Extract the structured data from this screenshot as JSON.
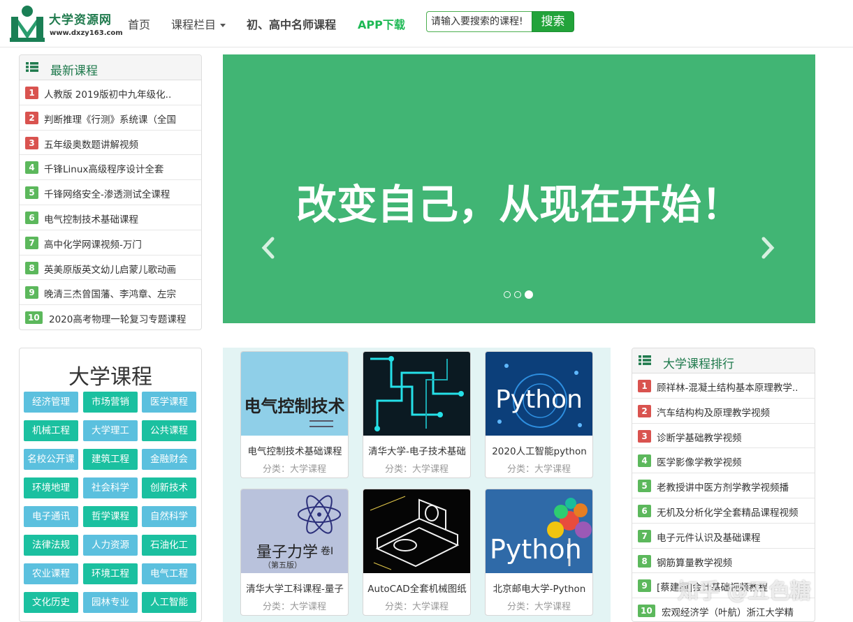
{
  "header": {
    "logo_title": "大学资源网",
    "logo_url": "www.dxzy163.com",
    "nav": {
      "home": "首页",
      "columns": "课程栏目",
      "teachers": "初、高中名师课程",
      "app": "APP下载"
    },
    "search": {
      "placeholder": "请输入要搜索的课程!",
      "button": "搜索"
    }
  },
  "latest": {
    "title": "最新课程",
    "items": [
      {
        "num": "1",
        "text": "人教版 2019版初中九年级化.."
      },
      {
        "num": "2",
        "text": "判断推理《行测》系统课（全国"
      },
      {
        "num": "3",
        "text": "五年级奥数题讲解视频"
      },
      {
        "num": "4",
        "text": "千锋Linux高级程序设计全套"
      },
      {
        "num": "5",
        "text": "千锋网络安全-渗透测试全课程"
      },
      {
        "num": "6",
        "text": "电气控制技术基础课程"
      },
      {
        "num": "7",
        "text": "高中化学网课视频-万门"
      },
      {
        "num": "8",
        "text": "英美原版英文幼儿启蒙儿歌动画"
      },
      {
        "num": "9",
        "text": "晚清三杰曾国藩、李鸿章、左宗"
      },
      {
        "num": "10",
        "text": "2020高考物理一轮复习专题课程"
      }
    ]
  },
  "banner": {
    "text": "改变自己，从现在开始！",
    "slide_count": 3,
    "active_slide": 3
  },
  "categories": {
    "title": "大学课程",
    "tags": [
      "经济管理",
      "市场营销",
      "医学课程",
      "机械工程",
      "大学理工",
      "公共课程",
      "名校公开课",
      "建筑工程",
      "金融财会",
      "环境地理",
      "社会科学",
      "创新技术",
      "电子通讯",
      "哲学课程",
      "自然科学",
      "法律法规",
      "人力资源",
      "石油化工",
      "农业课程",
      "环境工程",
      "电气工程",
      "文化历史",
      "园林专业",
      "人工智能"
    ]
  },
  "cards": [
    {
      "title": "电气控制技术基础课程",
      "meta": "分类：大学课程",
      "thumb_text": "电气控制技术"
    },
    {
      "title": "清华大学-电子技术基础",
      "meta": "分类：大学课程",
      "thumb_text": ""
    },
    {
      "title": "2020人工智能python",
      "meta": "分类：大学课程",
      "thumb_text": "Python"
    },
    {
      "title": "清华大学工科课程-量子",
      "meta": "分类：大学课程",
      "thumb_text": "量子力学",
      "thumb_sub": "卷I",
      "thumb_edition": "（第五版）"
    },
    {
      "title": "AutoCAD全套机械图纸",
      "meta": "分类：大学课程",
      "thumb_text": ""
    },
    {
      "title": "北京邮电大学-Python",
      "meta": "分类：大学课程",
      "thumb_text": "Python"
    }
  ],
  "ranking": {
    "title": "大学课程排行",
    "items": [
      {
        "num": "1",
        "text": "顾祥林-混凝土结构基本原理教学.."
      },
      {
        "num": "2",
        "text": "汽车结构构及原理教学视频"
      },
      {
        "num": "3",
        "text": "诊断学基础教学视频"
      },
      {
        "num": "4",
        "text": "医学影像学教学视频"
      },
      {
        "num": "5",
        "text": "老教授讲中医方剂学教学视频播"
      },
      {
        "num": "6",
        "text": "无机及分析化学全套精品课程视频"
      },
      {
        "num": "7",
        "text": "电子元件认识及基础课程"
      },
      {
        "num": "8",
        "text": "钢筋算量教学视频"
      },
      {
        "num": "9",
        "text": "[蔡建国]会计基础视频教程"
      },
      {
        "num": "10",
        "text": "宏观经济学（叶航）浙江大学精"
      }
    ]
  },
  "watermark": "知乎 @五色糖",
  "colors": {
    "brand_green": "#1f7a4d",
    "banner_green": "#41b574",
    "search_button": "#22a33a",
    "badge_red": "#d9534f",
    "badge_green": "#5cb85c",
    "tag_blue": "#5bc0de",
    "tag_teal": "#1bc0a0"
  }
}
